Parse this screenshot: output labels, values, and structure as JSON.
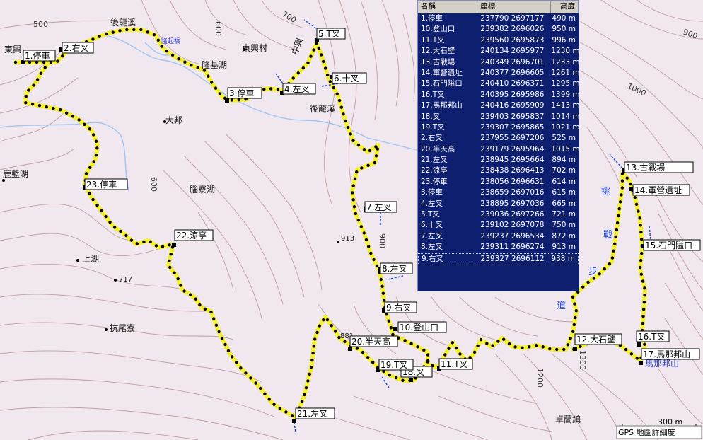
{
  "places": [
    {
      "name": "後龍溪",
      "id": "houlong-river-north"
    },
    {
      "name": "東興村",
      "id": "dongxing-village"
    },
    {
      "name": "隆基湖",
      "id": "longji-lake"
    },
    {
      "name": "大邦",
      "id": "dabang"
    },
    {
      "name": "後龍溪",
      "id": "houlong-river-south"
    },
    {
      "name": "腦寮湖",
      "id": "naoliao-lake"
    },
    {
      "name": "鹿藍湖",
      "id": "lulan-lake"
    },
    {
      "name": "上湖",
      "id": "shanghu"
    },
    {
      "name": "抗尾寮",
      "id": "kangwei-liao"
    },
    {
      "name": "卓蘭鎮",
      "id": "zhuolan-town"
    },
    {
      "name": "東興",
      "id": "dongxing"
    },
    {
      "name": "隆起橋",
      "id": "bridge-name"
    },
    {
      "name": "中興",
      "id": "zhongxing"
    },
    {
      "name": "馬那邦山",
      "id": "manabang-mountain"
    },
    {
      "name": "913",
      "id": "spot-913"
    },
    {
      "name": "717",
      "id": "spot-717"
    },
    {
      "name": "881",
      "id": "spot-881"
    }
  ],
  "contour_labels": [
    "500",
    "600",
    "700",
    "900",
    "1000",
    "1200",
    "1300",
    "900",
    "600"
  ],
  "challenge_text": [
    "挑",
    "戰",
    "步",
    "道"
  ],
  "waypoints": [
    {
      "label": "1.停車"
    },
    {
      "label": "2.右叉"
    },
    {
      "label": "3.停車"
    },
    {
      "label": "4.左叉"
    },
    {
      "label": "5.T叉"
    },
    {
      "label": "6.十叉"
    },
    {
      "label": "7.左叉"
    },
    {
      "label": "8.左叉"
    },
    {
      "label": "9.右叉"
    },
    {
      "label": "10.登山口"
    },
    {
      "label": "11.T叉"
    },
    {
      "label": "12.大石壁"
    },
    {
      "label": "13.古戰場"
    },
    {
      "label": "14.軍營遺址"
    },
    {
      "label": "15.石門隘口"
    },
    {
      "label": "16.T叉"
    },
    {
      "label": "17.馬那邦山"
    },
    {
      "label": "18.叉"
    },
    {
      "label": "19.T叉"
    },
    {
      "label": "20.半天高"
    },
    {
      "label": "21.左叉"
    },
    {
      "label": "22.涼亭"
    },
    {
      "label": "23.停車"
    }
  ],
  "table": {
    "headers": {
      "name": "名稱",
      "coord": "座標",
      "alt": "高度"
    },
    "rows": [
      {
        "name": "1.停車",
        "coord": "237790 2697177",
        "alt": "490 m"
      },
      {
        "name": "10.登山口",
        "coord": "239382 2696026",
        "alt": "950 m"
      },
      {
        "name": "11.T叉",
        "coord": "239560 2695873",
        "alt": "996 m"
      },
      {
        "name": "12.大石壁",
        "coord": "240134 2695977",
        "alt": "1230 m"
      },
      {
        "name": "13.古戰場",
        "coord": "240349 2696701",
        "alt": "1233 m"
      },
      {
        "name": "14.軍營遺址",
        "coord": "240377 2696605",
        "alt": "1261 m"
      },
      {
        "name": "15.石門隘口",
        "coord": "240410 2696371",
        "alt": "1295 m"
      },
      {
        "name": "16.T叉",
        "coord": "240395 2695986",
        "alt": "1399 m"
      },
      {
        "name": "17.馬那邦山",
        "coord": "240416 2695909",
        "alt": "1413 m"
      },
      {
        "name": "18.叉",
        "coord": "239403 2695837",
        "alt": "1014 m"
      },
      {
        "name": "19.T叉",
        "coord": "239307 2695865",
        "alt": "1021 m"
      },
      {
        "name": "2.右叉",
        "coord": "237955 2697206",
        "alt": "525 m"
      },
      {
        "name": "20.半天高",
        "coord": "239179 2695964",
        "alt": "1015 m"
      },
      {
        "name": "21.左叉",
        "coord": "238945 2695664",
        "alt": "894 m"
      },
      {
        "name": "22.涼亭",
        "coord": "238438 2696413",
        "alt": "702 m"
      },
      {
        "name": "23.停車",
        "coord": "238056 2696631",
        "alt": "614 m"
      },
      {
        "name": "3.停車",
        "coord": "238659 2697016",
        "alt": "615 m"
      },
      {
        "name": "4.左叉",
        "coord": "238895 2697036",
        "alt": "665 m"
      },
      {
        "name": "5.T叉",
        "coord": "239036 2697266",
        "alt": "721 m"
      },
      {
        "name": "6.十叉",
        "coord": "239102 2697078",
        "alt": "750 m"
      },
      {
        "name": "7.左叉",
        "coord": "239237 2696534",
        "alt": "872 m"
      },
      {
        "name": "8.左叉",
        "coord": "239311 2696274",
        "alt": "913 m"
      },
      {
        "name": "9.右叉",
        "coord": "239327 2696112",
        "alt": "938 m"
      }
    ]
  },
  "scale": "300 m",
  "footer": "GPS 地圖詳細度",
  "colors": {
    "background": "#f1e7ee",
    "track": "#f5f032",
    "panel": "#0d1f6e",
    "arrow": "#1b47d6",
    "contour": "#b4908e",
    "river": "#9fc5f5"
  }
}
